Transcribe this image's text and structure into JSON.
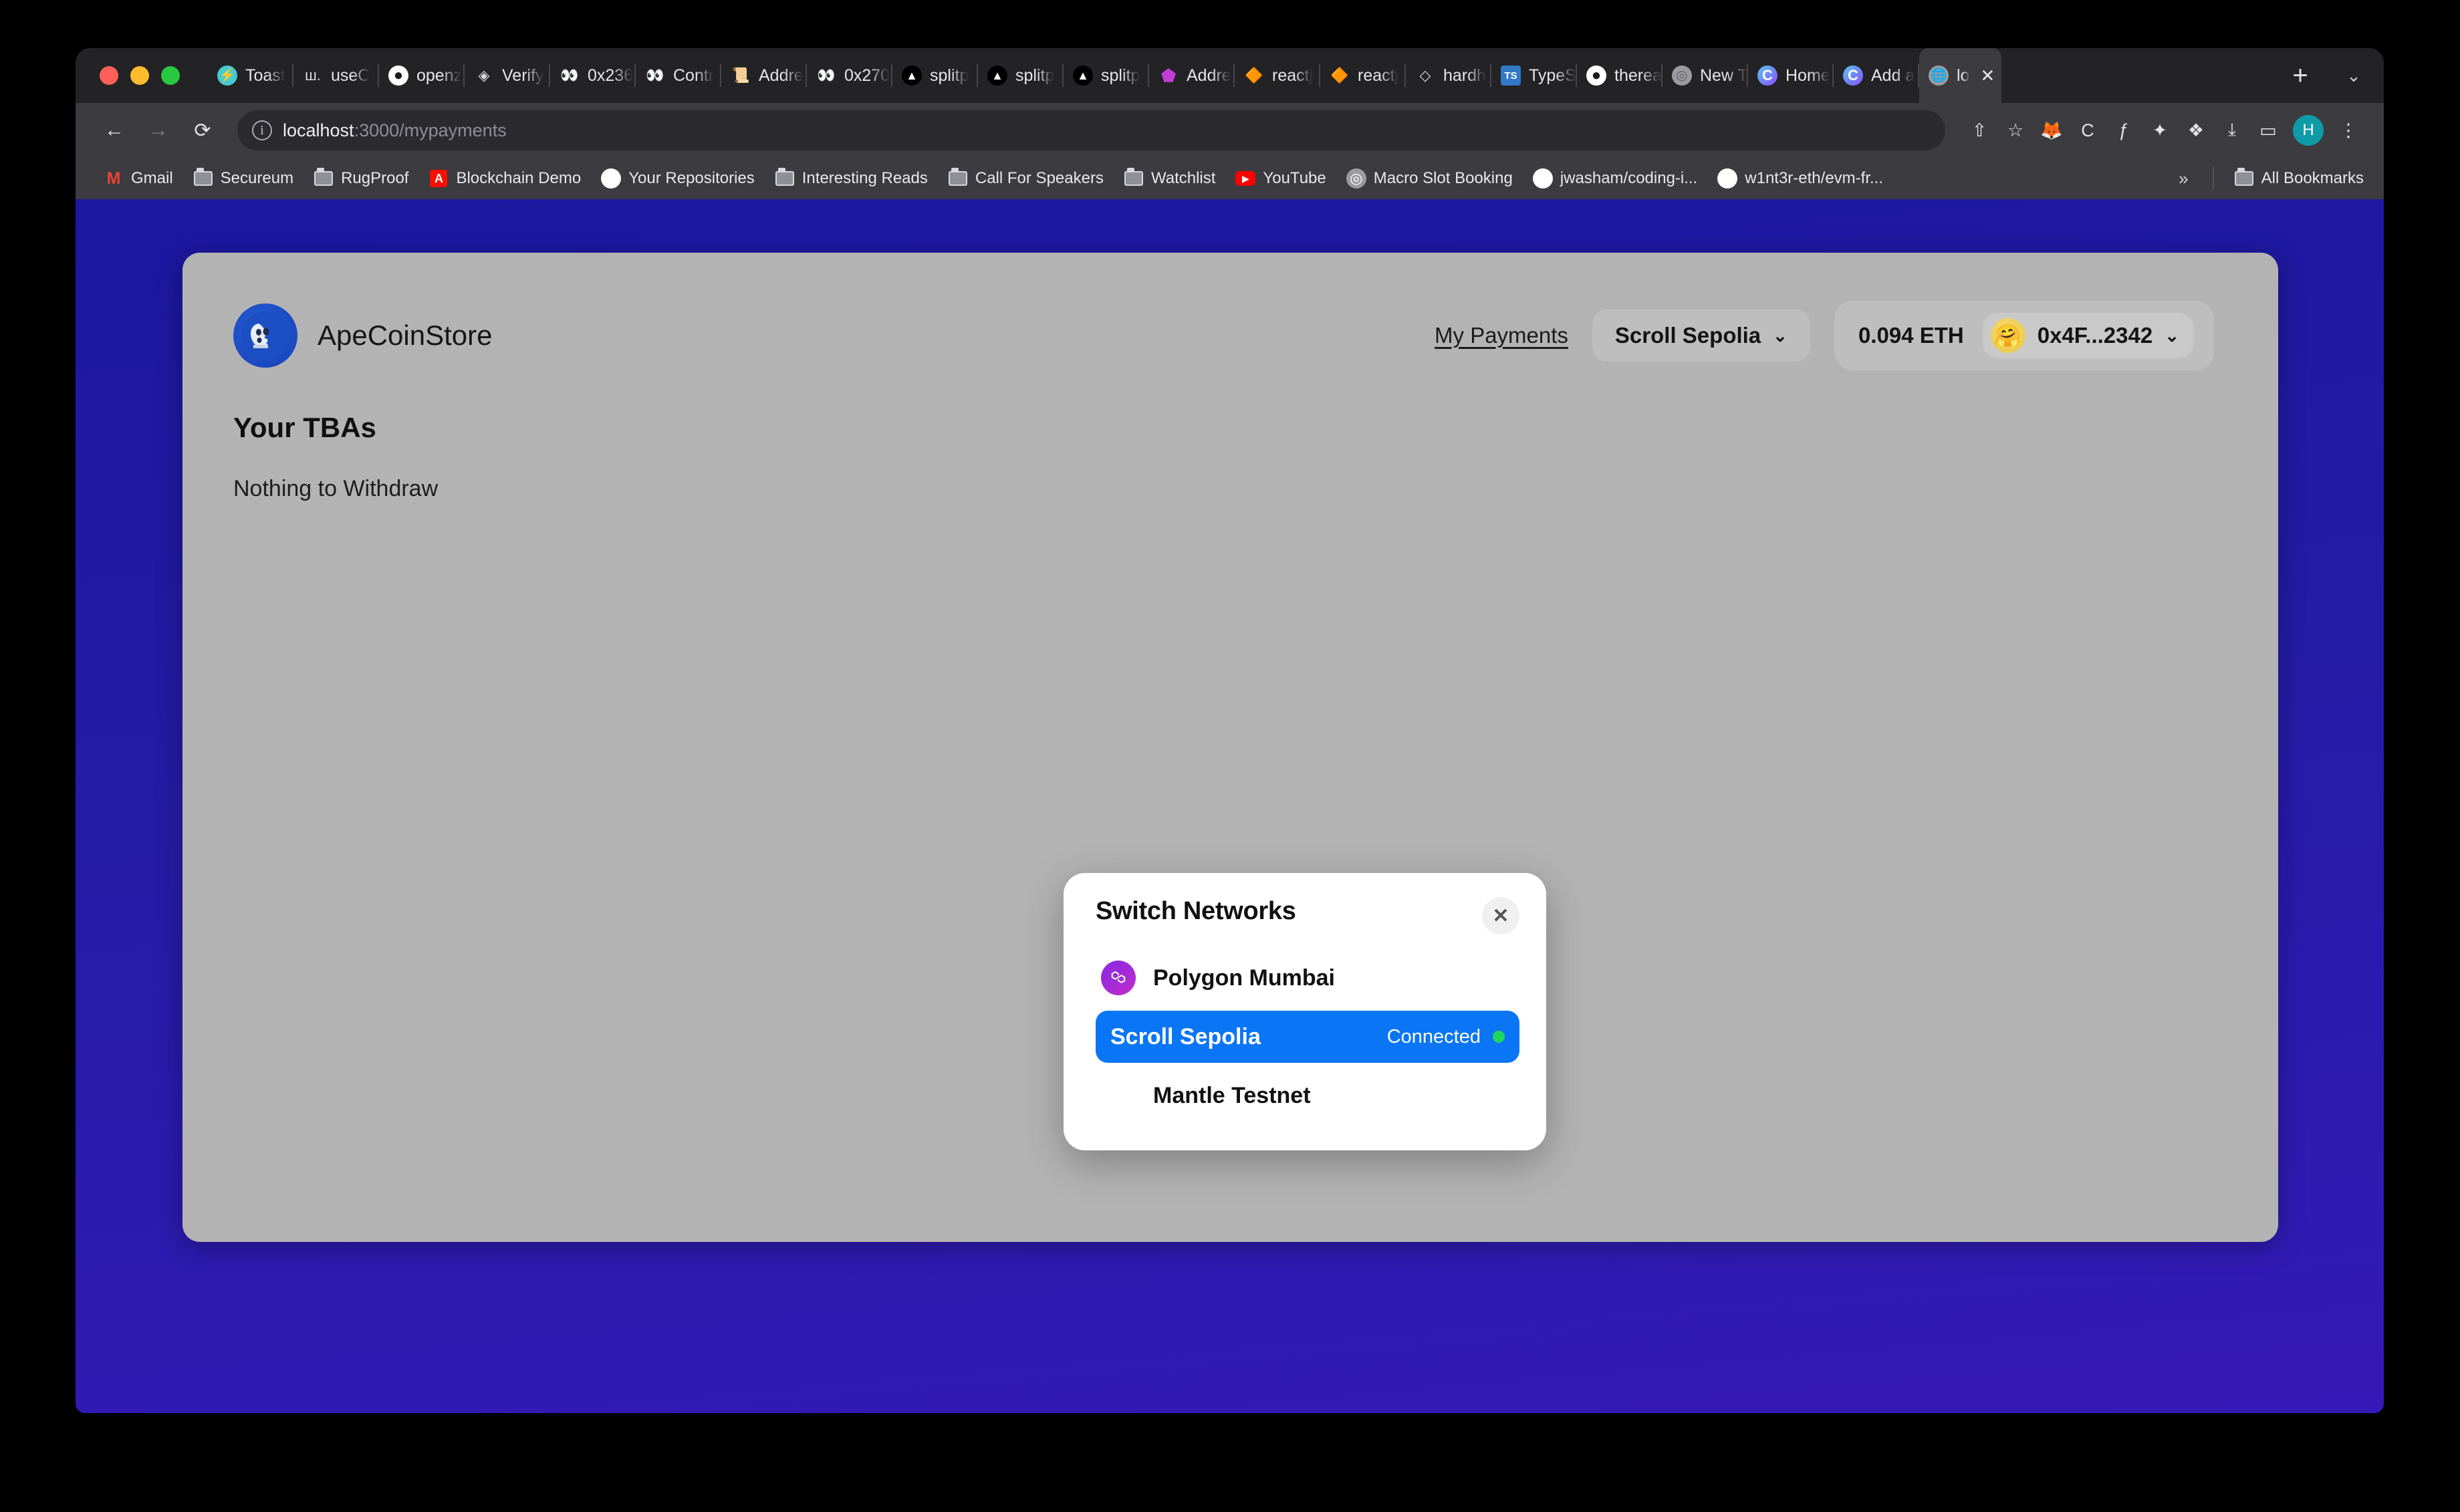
{
  "browser": {
    "traffic_lights": [
      "close",
      "minimize",
      "zoom"
    ],
    "tabs": [
      {
        "title": "Toast",
        "icon": "toast-icon",
        "glyph": "⚡",
        "favicon_class": "fv-toast",
        "active": false
      },
      {
        "title": "useC",
        "icon": "wagmi-icon",
        "glyph": "ш.",
        "favicon_class": "fv-plain",
        "active": false
      },
      {
        "title": "openz",
        "icon": "github-icon",
        "glyph": "●",
        "favicon_class": "fv-github",
        "active": false
      },
      {
        "title": "Verify",
        "icon": "etherscan-icon",
        "glyph": "◈",
        "favicon_class": "fv-plain",
        "active": false
      },
      {
        "title": "0x236",
        "icon": "blockscout-icon",
        "glyph": "👀",
        "favicon_class": "fv-plain",
        "active": false
      },
      {
        "title": "Contr",
        "icon": "blockscout-icon",
        "glyph": "👀",
        "favicon_class": "fv-plain",
        "active": false
      },
      {
        "title": "Addre",
        "icon": "scroll-icon",
        "glyph": "📜",
        "favicon_class": "fv-plain",
        "active": false
      },
      {
        "title": "0x270",
        "icon": "blockscout-icon",
        "glyph": "👀",
        "favicon_class": "fv-plain",
        "active": false
      },
      {
        "title": "splitp",
        "icon": "vercel-icon",
        "glyph": "▲",
        "favicon_class": "fv-splitp",
        "active": false
      },
      {
        "title": "splitp",
        "icon": "vercel-icon",
        "glyph": "▲",
        "favicon_class": "fv-splitp",
        "active": false
      },
      {
        "title": "splitp",
        "icon": "vercel-icon",
        "glyph": "▲",
        "favicon_class": "fv-splitp",
        "active": false
      },
      {
        "title": "Addre",
        "icon": "polygon-icon",
        "glyph": "⬟",
        "favicon_class": "fv-polygon",
        "active": false
      },
      {
        "title": "reactj",
        "icon": "react-query-icon",
        "glyph": "🔶",
        "favicon_class": "fv-plain",
        "active": false
      },
      {
        "title": "reactj",
        "icon": "react-query-icon",
        "glyph": "🔶",
        "favicon_class": "fv-plain",
        "active": false
      },
      {
        "title": "hardh",
        "icon": "hardhat-icon",
        "glyph": "◇",
        "favicon_class": "fv-plain",
        "active": false
      },
      {
        "title": "TypeS",
        "icon": "typescript-icon",
        "glyph": "TS",
        "favicon_class": "fv-ts",
        "active": false
      },
      {
        "title": "therea",
        "icon": "github-icon",
        "glyph": "●",
        "favicon_class": "fv-github",
        "active": false
      },
      {
        "title": "New T",
        "icon": "chrome-icon",
        "glyph": "◎",
        "favicon_class": "fv-globe",
        "active": false
      },
      {
        "title": "Home",
        "icon": "coinbase-icon",
        "glyph": "C",
        "favicon_class": "fv-chrome",
        "active": false
      },
      {
        "title": "Add a",
        "icon": "coinbase-icon",
        "glyph": "C",
        "favicon_class": "fv-chrome",
        "active": false
      },
      {
        "title": "lo",
        "icon": "globe-icon",
        "glyph": "🌐",
        "favicon_class": "fv-globe",
        "active": true
      }
    ],
    "tab_close_label": "✕",
    "new_tab_label": "+",
    "tab_list_label": "⌄",
    "nav": {
      "back": "←",
      "forward": "→",
      "reload": "⟳"
    },
    "omnibox": {
      "info_icon": "i",
      "url_host": "localhost",
      "url_rest": ":3000/mypayments"
    },
    "toolbar_icons": [
      {
        "name": "share-icon",
        "glyph": "⇧"
      },
      {
        "name": "bookmark-star-icon",
        "glyph": "☆"
      },
      {
        "name": "metamask-icon",
        "glyph": "🦊"
      },
      {
        "name": "coinbase-wallet-icon",
        "glyph": "C"
      },
      {
        "name": "fonts-icon",
        "glyph": "ƒ"
      },
      {
        "name": "ai-extension-icon",
        "glyph": "✦"
      },
      {
        "name": "extensions-puzzle-icon",
        "glyph": "❖"
      },
      {
        "name": "downloads-icon",
        "glyph": "⤓"
      },
      {
        "name": "side-panel-icon",
        "glyph": "▭"
      }
    ],
    "profile_initial": "H",
    "menu_icon": "⋮",
    "bookmarks": [
      {
        "label": "Gmail",
        "icon": "gmail-icon",
        "type": "gmail"
      },
      {
        "label": "Secureum",
        "icon": "folder-icon",
        "type": "folder"
      },
      {
        "label": "RugProof",
        "icon": "folder-icon",
        "type": "folder"
      },
      {
        "label": "Blockchain Demo",
        "icon": "adobe-icon",
        "type": "adobe"
      },
      {
        "label": "Your Repositories",
        "icon": "github-icon",
        "type": "github"
      },
      {
        "label": "Interesting Reads",
        "icon": "folder-icon",
        "type": "folder"
      },
      {
        "label": "Call For Speakers",
        "icon": "folder-icon",
        "type": "folder"
      },
      {
        "label": "Watchlist",
        "icon": "folder-icon",
        "type": "folder"
      },
      {
        "label": "YouTube",
        "icon": "youtube-icon",
        "type": "youtube"
      },
      {
        "label": "Macro Slot Booking",
        "icon": "globe-icon",
        "type": "globe"
      },
      {
        "label": "jwasham/coding-i...",
        "icon": "github-icon",
        "type": "github"
      },
      {
        "label": "w1nt3r-eth/evm-fr...",
        "icon": "github-icon",
        "type": "github"
      }
    ],
    "bookmarks_overflow": "»",
    "all_bookmarks_label": "All Bookmarks"
  },
  "app": {
    "brand_name": "ApeCoinStore",
    "brand_logo_glyph": "🦍",
    "my_payments_label": "My Payments",
    "network_label": "Scroll Sepolia",
    "network_chevron": "⌄",
    "balance": "0.094 ETH",
    "wallet_address": "0x4F...2342",
    "wallet_avatar_glyph": "🤗",
    "wallet_chevron": "⌄",
    "section_title": "Your TBAs",
    "empty_message": "Nothing to Withdraw"
  },
  "modal": {
    "title": "Switch Networks",
    "close_label": "✕",
    "networks": [
      {
        "name": "Polygon Mumbai",
        "icon": "polygon-icon",
        "icon_class": "polygon",
        "selected": false,
        "status": ""
      },
      {
        "name": "Scroll Sepolia",
        "icon": "none",
        "icon_class": "blank",
        "selected": true,
        "status": "Connected"
      },
      {
        "name": "Mantle Testnet",
        "icon": "none",
        "icon_class": "blank",
        "selected": false,
        "status": ""
      }
    ]
  },
  "colors": {
    "accent_blue": "#0b76f5",
    "page_gradient_top": "#1b17a0",
    "page_gradient_bottom": "#3519b8",
    "card_bg": "#b3b3b3",
    "connected_dot": "#1ed760",
    "polygon_purple": "#8a2be2"
  }
}
